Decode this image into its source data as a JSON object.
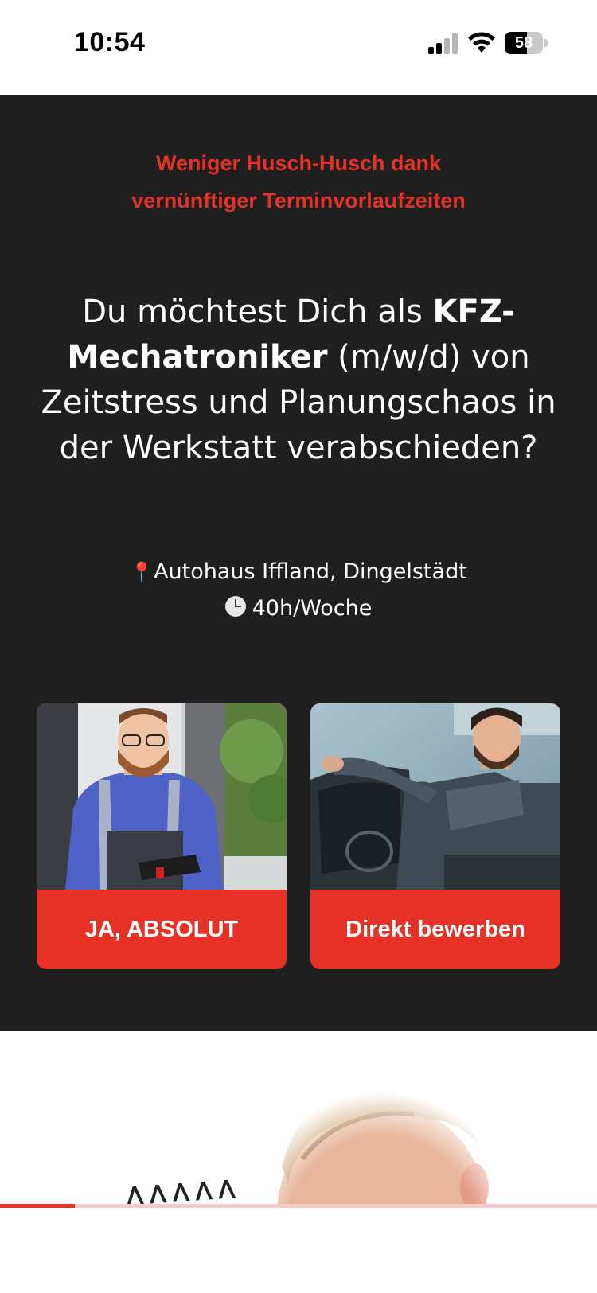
{
  "status_bar": {
    "time": "10:54",
    "battery": "58",
    "battery_level": 0.58
  },
  "hero": {
    "kicker_line1": "Weniger Husch-Husch dank",
    "kicker_line2": "vernünftiger Terminvorlaufzeiten",
    "headline_pre": "Du möchtest Dich als ",
    "headline_bold": "KFZ-Mechatroniker",
    "headline_post": " (m/w/d) von Zeitstress und Planungschaos in der Werkstatt verabschieden?",
    "location": "Autohaus Iffland, Dingelstädt",
    "hours": "40h/Woche"
  },
  "cards": [
    {
      "button_label": "JA, ABSOLUT"
    },
    {
      "button_label": "Direkt bewerben"
    }
  ],
  "progress": {
    "fraction": 0.125
  },
  "colors": {
    "accent": "#e63226",
    "dark_bg": "#1f1f20",
    "text_light": "#ffffff"
  }
}
